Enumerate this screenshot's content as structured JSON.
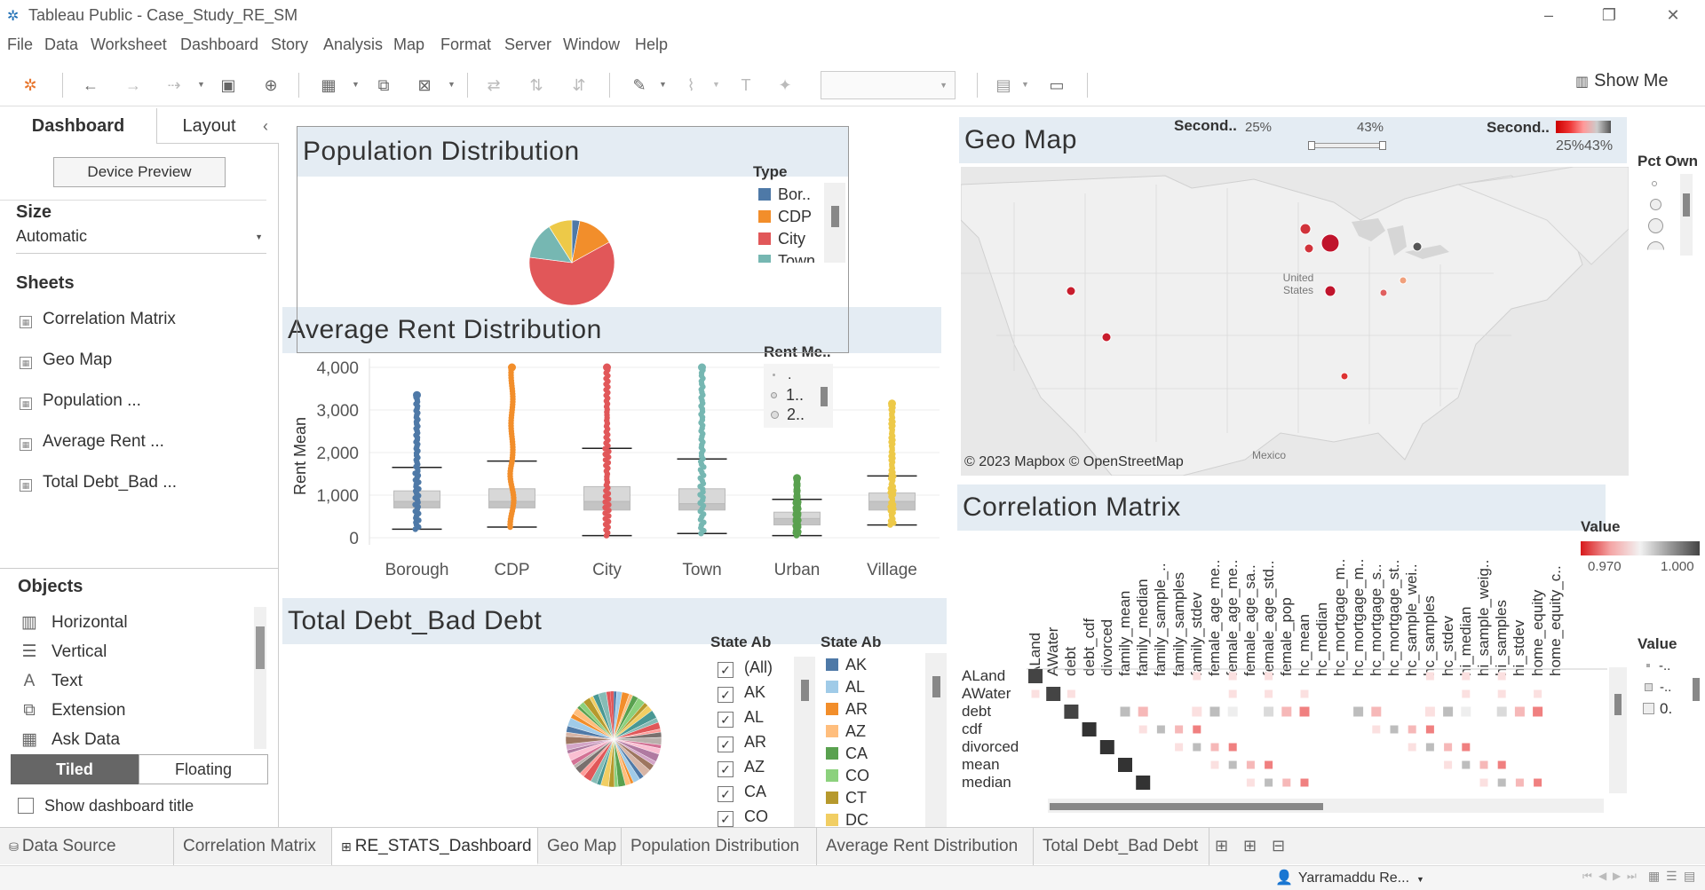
{
  "window": {
    "title": "Tableau Public - Case_Study_RE_SM",
    "min": "–",
    "restore": "❐",
    "close": "✕"
  },
  "menu": [
    "File",
    "Data",
    "Worksheet",
    "Dashboard",
    "Story",
    "Analysis",
    "Map",
    "Format",
    "Server",
    "Window",
    "Help"
  ],
  "toolbar": {
    "show_me": "Show Me"
  },
  "leftpane": {
    "tab_dashboard": "Dashboard",
    "tab_layout": "Layout",
    "collapse": "‹",
    "device_preview": "Device Preview",
    "size_label": "Size",
    "size_value": "Automatic",
    "sheets_label": "Sheets",
    "sheets": [
      "Correlation Matrix",
      "Geo Map",
      "Population ...",
      "Average Rent ...",
      "Total Debt_Bad ..."
    ],
    "objects_label": "Objects",
    "objects": [
      {
        "label": "Horizontal",
        "icon": "horizontal-icon"
      },
      {
        "label": "Vertical",
        "icon": "vertical-icon"
      },
      {
        "label": "Text",
        "icon": "text-icon"
      },
      {
        "label": "Extension",
        "icon": "extension-icon"
      },
      {
        "label": "Ask Data",
        "icon": "ask-data-icon"
      }
    ],
    "tiled": "Tiled",
    "floating": "Floating",
    "show_title": "Show dashboard title"
  },
  "population": {
    "title": "Population Distribution",
    "legend_title": "Type",
    "legend": [
      {
        "label": "Bor..",
        "color": "#4e79a7"
      },
      {
        "label": "CDP",
        "color": "#f28e2b"
      },
      {
        "label": "City",
        "color": "#e15759"
      },
      {
        "label": "Town",
        "color": "#76b7b2"
      }
    ]
  },
  "rent": {
    "title": "Average Rent Distribution",
    "ylabel": "Rent Mean",
    "legend_title": "Rent Me..",
    "legend": [
      ".",
      "1..",
      "2.."
    ]
  },
  "geomap": {
    "title": "Geo Map",
    "filter1_label": "Second..",
    "filter1_min": "25%",
    "filter1_max": "43%",
    "filter2_label": "Second..",
    "filter2_range": "25%43%",
    "legend_title": "Pct Own",
    "credits": "© 2023 Mapbox © OpenStreetMap",
    "label_us": "United States",
    "label_mexico": "Mexico"
  },
  "corr": {
    "title": "Correlation Matrix",
    "legend_title": "Value",
    "legend_min": "0.970",
    "legend_max": "1.000",
    "legend2_title": "Value",
    "legend2_items": [
      "-..",
      "-..",
      "0."
    ],
    "columns": [
      "ALand",
      "AWater",
      "debt",
      "debt_cdf",
      "divorced",
      "family_mean",
      "family_median",
      "family_sample_..",
      "family_samples",
      "family_stdev",
      "female_age_me..",
      "female_age_me..",
      "female_age_sa..",
      "female_age_std..",
      "female_pop",
      "hc_mean",
      "hc_median",
      "hc_mortgage_m..",
      "hc_mortgage_m..",
      "hc_mortgage_s..",
      "hc_mortgage_st..",
      "hc_sample_wei..",
      "hc_samples",
      "hc_stdev",
      "hi_median",
      "hi_sample_weig..",
      "hi_samples",
      "hi_stdev",
      "home_equity",
      "home_equity_c.."
    ],
    "rows": [
      "ALand",
      "AWater",
      "debt",
      "cdf",
      "divorced",
      "mean",
      "median"
    ]
  },
  "debt": {
    "title": "Total Debt_Bad Debt",
    "filter_title": "State Ab",
    "filter_items": [
      "(All)",
      "AK",
      "AL",
      "AR",
      "AZ",
      "CA",
      "CO"
    ],
    "legend_title": "State Ab",
    "legend": [
      {
        "label": "AK",
        "color": "#4e79a7"
      },
      {
        "label": "AL",
        "color": "#a0cbe8"
      },
      {
        "label": "AR",
        "color": "#f28e2b"
      },
      {
        "label": "AZ",
        "color": "#ffbe7d"
      },
      {
        "label": "CA",
        "color": "#59a14f"
      },
      {
        "label": "CO",
        "color": "#8cd17d"
      },
      {
        "label": "CT",
        "color": "#b6992d"
      },
      {
        "label": "DC",
        "color": "#f1ce63"
      }
    ]
  },
  "tabs": [
    "Data Source",
    "Correlation Matrix",
    "RE_STATS_Dashboard",
    "Geo Map",
    "Population Distribution",
    "Average Rent Distribution",
    "Total Debt_Bad Debt"
  ],
  "status": {
    "user": "Yarramaddu Re..."
  },
  "chart_data": [
    {
      "type": "pie",
      "title": "Population Distribution",
      "categories": [
        "Borough",
        "CDP",
        "City",
        "Town",
        "Village"
      ],
      "values": [
        3,
        14,
        60,
        14,
        9
      ]
    },
    {
      "type": "box",
      "title": "Average Rent Distribution",
      "ylabel": "Rent Mean",
      "ylim": [
        0,
        4000
      ],
      "yticks": [
        "0",
        "1,000",
        "2,000",
        "3,000",
        "4,000"
      ],
      "categories": [
        "Borough",
        "CDP",
        "City",
        "Town",
        "Urban",
        "Village"
      ],
      "colors": [
        "#4e79a7",
        "#f28e2b",
        "#e15759",
        "#76b7b2",
        "#59a14f",
        "#edc948"
      ],
      "whisker_low": [
        200,
        250,
        50,
        100,
        50,
        300
      ],
      "q1": [
        700,
        700,
        650,
        650,
        300,
        650
      ],
      "median": [
        850,
        850,
        850,
        800,
        450,
        850
      ],
      "q3": [
        1100,
        1150,
        1200,
        1150,
        600,
        1050
      ],
      "whisker_high": [
        1650,
        1800,
        2100,
        1850,
        900,
        1450
      ],
      "max": [
        3350,
        4000,
        4000,
        4000,
        1400,
        3150
      ]
    }
  ]
}
